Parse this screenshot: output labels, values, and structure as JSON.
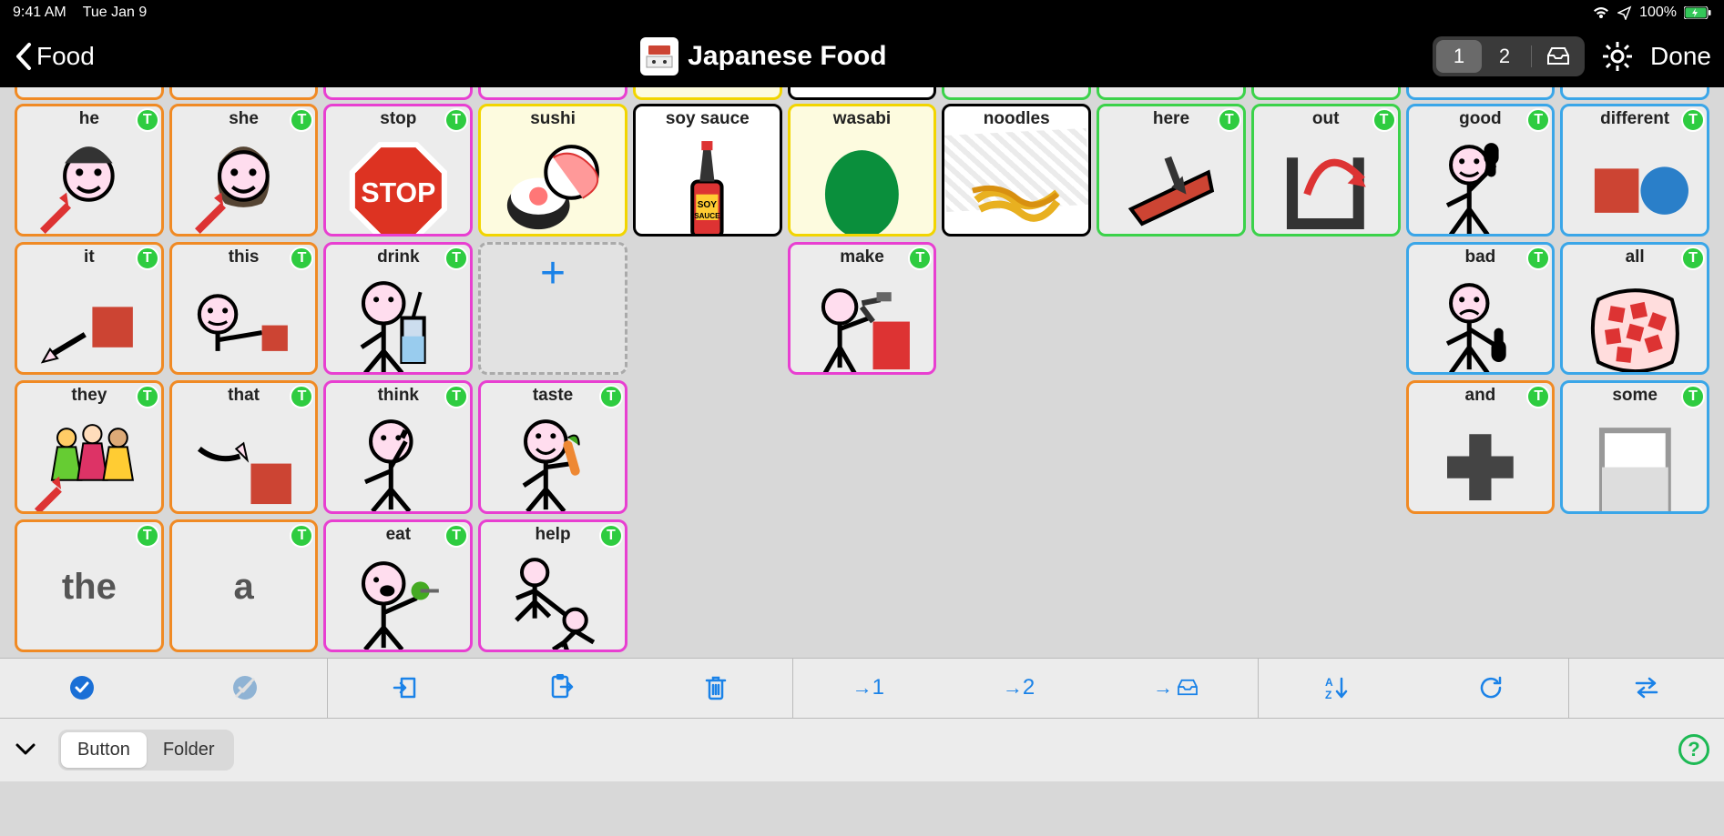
{
  "status": {
    "time": "9:41 AM",
    "date": "Tue Jan 9",
    "battery": "100%"
  },
  "nav": {
    "back_label": "Food",
    "title": "Japanese Food",
    "view1": "1",
    "view2": "2",
    "done": "Done"
  },
  "peek_colors": [
    "orange",
    "orange",
    "pink",
    "pink",
    "yellow",
    "black",
    "green",
    "green",
    "green",
    "blue",
    "blue"
  ],
  "rows": [
    [
      {
        "label": "he",
        "color": "orange",
        "badge": true,
        "icon": "person-he"
      },
      {
        "label": "she",
        "color": "orange",
        "badge": true,
        "icon": "person-she"
      },
      {
        "label": "stop",
        "color": "pink",
        "badge": true,
        "icon": "stop-sign"
      },
      {
        "label": "sushi",
        "color": "yellow",
        "folder": true,
        "icon": "sushi"
      },
      {
        "label": "soy sauce",
        "color": "black",
        "folder": true,
        "icon": "soy"
      },
      {
        "label": "wasabi",
        "color": "yellow",
        "folder": true,
        "icon": "wasabi"
      },
      {
        "label": "noodles",
        "color": "black",
        "folder": true,
        "icon": "noodles",
        "cls": "noodles"
      },
      {
        "label": "here",
        "color": "green",
        "badge": true,
        "icon": "here"
      },
      {
        "label": "out",
        "color": "green",
        "badge": true,
        "icon": "out"
      },
      {
        "label": "good",
        "color": "blue",
        "badge": true,
        "icon": "good"
      },
      {
        "label": "different",
        "color": "blue",
        "badge": true,
        "icon": "different"
      }
    ],
    [
      {
        "label": "it",
        "color": "orange",
        "badge": true,
        "icon": "it"
      },
      {
        "label": "this",
        "color": "orange",
        "badge": true,
        "icon": "this"
      },
      {
        "label": "drink",
        "color": "pink",
        "badge": true,
        "icon": "drink"
      },
      {
        "type": "add"
      },
      {
        "type": "empty"
      },
      {
        "label": "make",
        "color": "pink",
        "badge": true,
        "icon": "make"
      },
      {
        "type": "empty"
      },
      {
        "type": "empty"
      },
      {
        "type": "empty"
      },
      {
        "label": "bad",
        "color": "blue",
        "badge": true,
        "icon": "bad"
      },
      {
        "label": "all",
        "color": "blue",
        "badge": true,
        "icon": "all"
      }
    ],
    [
      {
        "label": "they",
        "color": "orange",
        "badge": true,
        "icon": "they"
      },
      {
        "label": "that",
        "color": "orange",
        "badge": true,
        "icon": "that"
      },
      {
        "label": "think",
        "color": "pink",
        "badge": true,
        "icon": "think"
      },
      {
        "label": "taste",
        "color": "pink",
        "badge": true,
        "icon": "taste"
      },
      {
        "type": "empty"
      },
      {
        "type": "empty"
      },
      {
        "type": "empty"
      },
      {
        "type": "empty"
      },
      {
        "type": "empty"
      },
      {
        "label": "and",
        "color": "orange",
        "badge": true,
        "icon": "and"
      },
      {
        "label": "some",
        "color": "blue",
        "badge": true,
        "icon": "some"
      }
    ],
    [
      {
        "label": "the",
        "color": "orange",
        "badge": true,
        "big": true
      },
      {
        "label": "a",
        "color": "orange",
        "badge": true,
        "big": true
      },
      {
        "label": "eat",
        "color": "pink",
        "badge": true,
        "icon": "eat"
      },
      {
        "label": "help",
        "color": "pink",
        "badge": true,
        "icon": "help"
      },
      {
        "type": "empty"
      },
      {
        "type": "empty"
      },
      {
        "type": "empty"
      },
      {
        "type": "empty"
      },
      {
        "type": "empty"
      },
      {
        "type": "empty"
      },
      {
        "type": "empty"
      }
    ]
  ],
  "toolbar": {
    "move1": "→1",
    "move2": "→2"
  },
  "bottom": {
    "seg_button": "Button",
    "seg_folder": "Folder",
    "help": "?"
  }
}
